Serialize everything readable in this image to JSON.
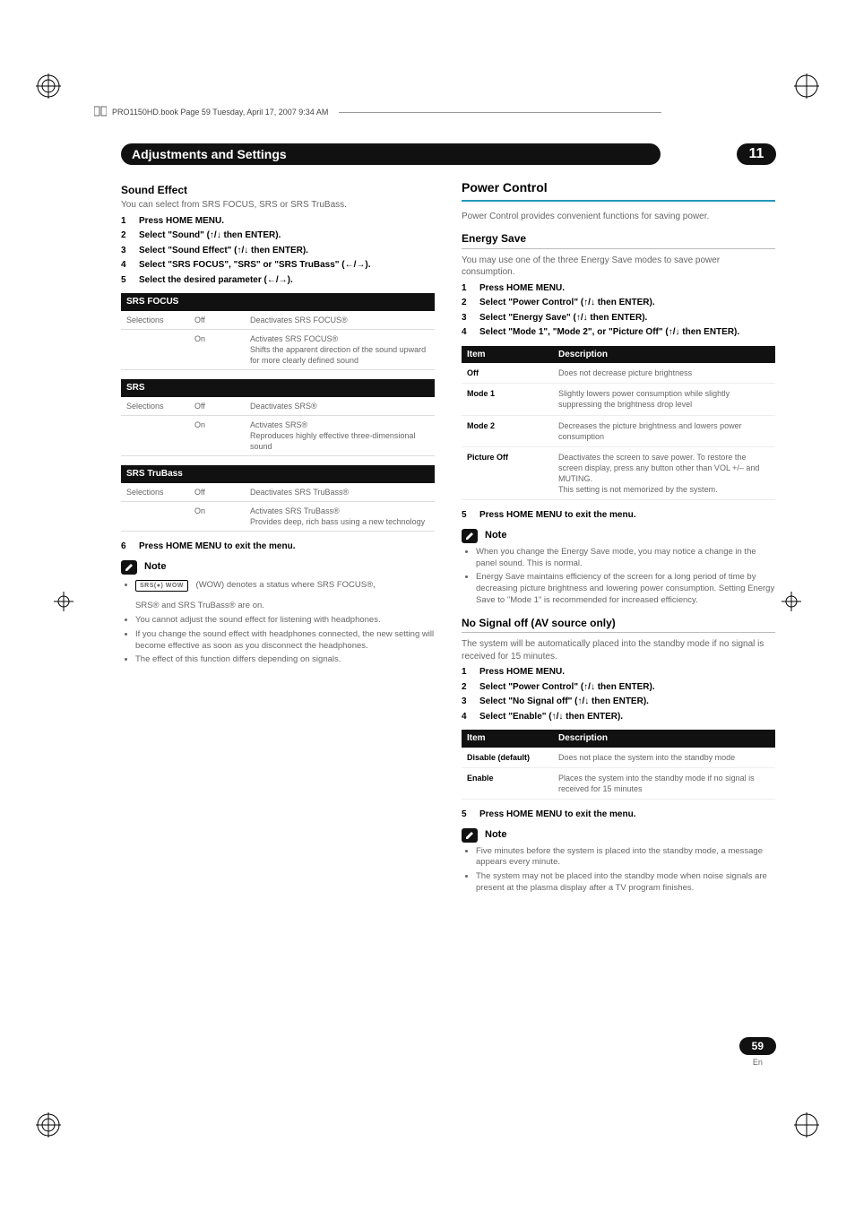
{
  "bookline": "PRO1150HD.book  Page 59  Tuesday, April 17, 2007  9:34 AM",
  "chapter_title": "Adjustments and Settings",
  "chapter_number": "11",
  "left": {
    "sound_effect_heading": "Sound Effect",
    "sound_effect_intro": "You can select from SRS FOCUS, SRS or SRS TruBass.",
    "steps": [
      "Press HOME MENU.",
      "Select \"Sound\" (↑/↓ then ENTER).",
      "Select \"Sound Effect\" (↑/↓ then ENTER).",
      "Select \"SRS FOCUS\", \"SRS\" or \"SRS TruBass\" (←/→).",
      "Select the desired parameter (←/→)."
    ],
    "tables": [
      {
        "head": "SRS FOCUS",
        "rows": [
          {
            "label": "Selections",
            "state": "Off",
            "desc": "Deactivates SRS FOCUS®"
          },
          {
            "label": "",
            "state": "On",
            "desc": "Activates SRS FOCUS®\nShifts the apparent direction of the sound upward for more clearly defined sound"
          }
        ]
      },
      {
        "head": "SRS",
        "rows": [
          {
            "label": "Selections",
            "state": "Off",
            "desc": "Deactivates SRS®"
          },
          {
            "label": "",
            "state": "On",
            "desc": "Activates SRS®\nReproduces highly effective three-dimensional sound"
          }
        ]
      },
      {
        "head": "SRS TruBass",
        "rows": [
          {
            "label": "Selections",
            "state": "Off",
            "desc": "Deactivates SRS TruBass®"
          },
          {
            "label": "",
            "state": "On",
            "desc": "Activates SRS TruBass®\nProvides deep, rich bass using a new technology"
          }
        ]
      }
    ],
    "step6_num": "6",
    "step6": "Press HOME MENU to exit the menu.",
    "note_label": "Note",
    "note1_logo": "SRS(●) WOW",
    "note1_text": " (WOW) denotes a status where SRS FOCUS®,",
    "note1_line2": "SRS® and SRS TruBass® are on.",
    "note_bullets": [
      "You cannot adjust the sound effect for listening with headphones.",
      "If you change the sound effect with headphones connected, the new setting will become effective as soon as you disconnect the headphones.",
      "The effect of this function differs depending on signals."
    ]
  },
  "right": {
    "power_control_heading": "Power Control",
    "power_control_intro": "Power Control provides convenient functions for saving power.",
    "energy_save_heading": "Energy Save",
    "energy_save_intro": "You may use one of the three Energy Save modes to save power consumption.",
    "energy_steps": [
      "Press HOME MENU.",
      "Select \"Power Control\" (↑/↓ then ENTER).",
      "Select \"Energy Save\" (↑/↓ then ENTER).",
      "Select \"Mode 1\", \"Mode 2\", or \"Picture Off\" (↑/↓ then ENTER)."
    ],
    "energy_table_head_item": "Item",
    "energy_table_head_desc": "Description",
    "energy_rows": [
      {
        "item": "Off",
        "desc": "Does not decrease picture brightness"
      },
      {
        "item": "Mode 1",
        "desc": "Slightly lowers power consumption while slightly suppressing the brightness drop level"
      },
      {
        "item": "Mode 2",
        "desc": "Decreases the picture brightness and lowers power consumption"
      },
      {
        "item": "Picture Off",
        "desc": "Deactivates the screen to save power. To restore the screen display, press any button other than VOL +/– and MUTING.\nThis setting is not memorized by the system."
      }
    ],
    "energy_step5_num": "5",
    "energy_step5": "Press HOME MENU to exit the menu.",
    "note_label": "Note",
    "energy_note_bullets": [
      "When you change the Energy Save mode, you may notice a change in the panel sound. This is normal.",
      "Energy Save maintains efficiency of the screen for a long period of time by decreasing picture brightness and lowering power consumption. Setting Energy Save to \"Mode 1\" is recommended for increased efficiency."
    ],
    "nosignal_heading": "No Signal off (AV source only)",
    "nosignal_intro": "The system will be automatically placed into the standby mode if no signal is received for 15 minutes.",
    "nosignal_steps": [
      "Press HOME MENU.",
      "Select \"Power Control\" (↑/↓ then ENTER).",
      "Select \"No Signal off\" (↑/↓ then ENTER).",
      "Select \"Enable\" (↑/↓ then ENTER)."
    ],
    "nosignal_table_head_item": "Item",
    "nosignal_table_head_desc": "Description",
    "nosignal_rows": [
      {
        "item": "Disable (default)",
        "desc": "Does not place the system into the standby mode"
      },
      {
        "item": "Enable",
        "desc": "Places the system into the standby mode if no signal is received for 15 minutes"
      }
    ],
    "nosignal_step5_num": "5",
    "nosignal_step5": "Press HOME MENU to exit the menu.",
    "nosignal_note_bullets": [
      "Five minutes before the system is placed into the standby mode, a message appears every minute.",
      "The system may not be placed into the standby mode when noise signals are present at the plasma display after a TV program finishes."
    ]
  },
  "page_number": "59",
  "page_lang": "En"
}
